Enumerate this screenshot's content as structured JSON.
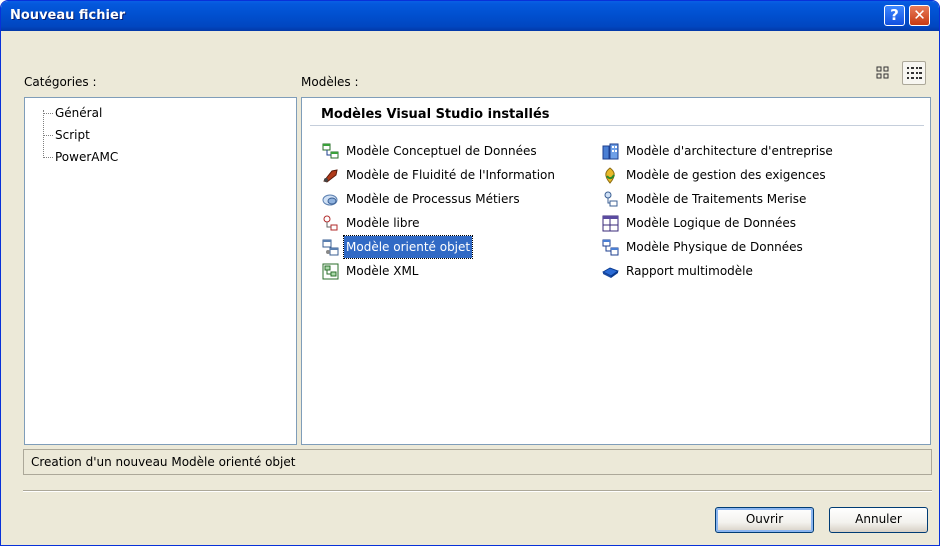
{
  "window": {
    "title": "Nouveau fichier",
    "help_label": "?",
    "close_label": "✕"
  },
  "categories": {
    "label": "Catégories :",
    "items": [
      "Général",
      "Script",
      "PowerAMC"
    ],
    "selected": "PowerAMC"
  },
  "models": {
    "label": "Modèles :",
    "group_title": "Modèles Visual Studio installés",
    "column1": [
      {
        "label": "Modèle Conceptuel de Données",
        "icon": "cdm-icon"
      },
      {
        "label": "Modèle de Fluidité de l'Information",
        "icon": "ilm-icon"
      },
      {
        "label": "Modèle de Processus Métiers",
        "icon": "bpm-icon"
      },
      {
        "label": "Modèle libre",
        "icon": "free-model-icon"
      },
      {
        "label": "Modèle orienté objet",
        "icon": "oom-icon",
        "selected": true
      },
      {
        "label": "Modèle XML",
        "icon": "xml-model-icon"
      }
    ],
    "column2": [
      {
        "label": "Modèle d'architecture d'entreprise",
        "icon": "eam-icon"
      },
      {
        "label": "Modèle de gestion des exigences",
        "icon": "rqm-icon"
      },
      {
        "label": "Modèle de Traitements Merise",
        "icon": "merise-icon"
      },
      {
        "label": "Modèle Logique de Données",
        "icon": "ldm-icon"
      },
      {
        "label": "Modèle Physique de Données",
        "icon": "pdm-icon"
      },
      {
        "label": "Rapport multimodèle",
        "icon": "multimodel-report-icon"
      }
    ]
  },
  "status": {
    "text": "Creation d'un nouveau Modèle orienté objet"
  },
  "buttons": {
    "ok": "Ouvrir",
    "cancel": "Annuler"
  },
  "colors": {
    "title_bar": "#0150d0",
    "selection": "#316ac5",
    "dialog_bg": "#ece9d8"
  }
}
